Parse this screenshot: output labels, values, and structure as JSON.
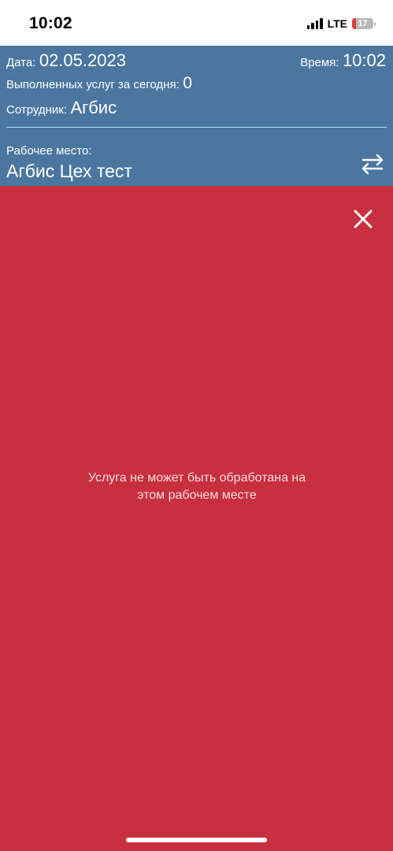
{
  "status_bar": {
    "time": "10:02",
    "network": "LTE",
    "battery_level": "17",
    "battery_fraction": 0.17,
    "icons": [
      "signal-icon",
      "battery-icon"
    ]
  },
  "header": {
    "date_label": "Дата:",
    "date_value": "02.05.2023",
    "time_label": "Время:",
    "time_value": "10:02",
    "services_label": "Выполненных услуг за сегодня:",
    "services_value": "0",
    "employee_label": "Сотрудник:",
    "employee_value": "Агбис",
    "workplace_label": "Рабочее место:",
    "workplace_value": "Агбис Цех тест",
    "switch_icon": "swap-arrows-icon"
  },
  "error": {
    "close_icon": "close-icon",
    "message_line1": "Услуга не может быть обработана на",
    "message_line2": "этом рабочем месте"
  },
  "colors": {
    "header_bg": "#4b76a0",
    "error_bg": "#c82f3f",
    "divider": "#a8e0f4",
    "battery_low": "#e23b3b"
  }
}
